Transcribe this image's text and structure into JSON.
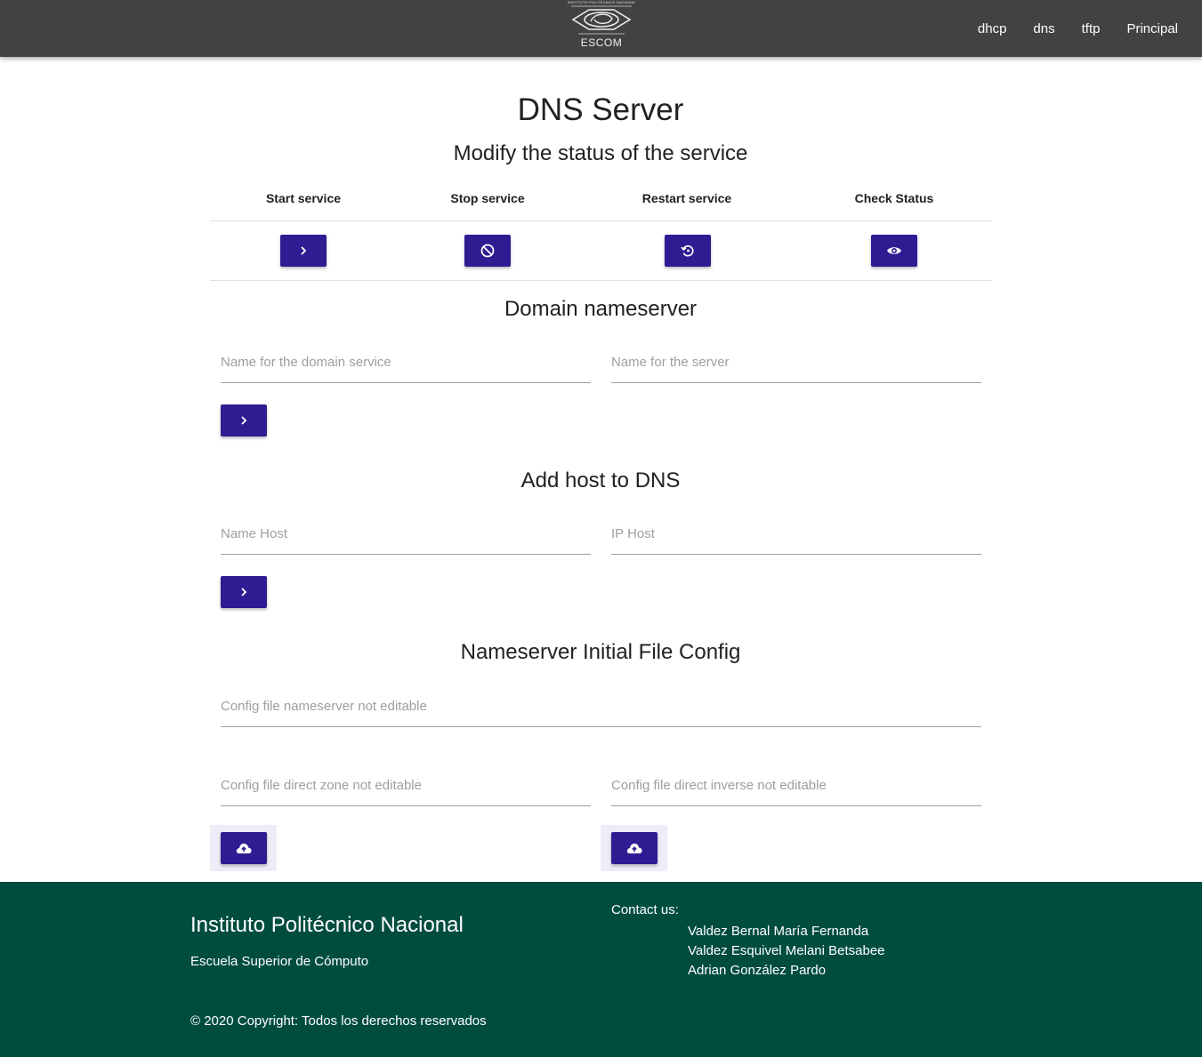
{
  "navbar": {
    "logo": {
      "small_text": "INSTITUTO POLITÉCNICO NACIONAL",
      "text": "ESCOM"
    },
    "links": [
      "dhcp",
      "dns",
      "tftp",
      "Principal"
    ]
  },
  "page": {
    "title": "DNS Server",
    "service_section": {
      "heading": "Modify the status of the service",
      "columns": [
        "Start service",
        "Stop service",
        "Restart service",
        "Check Status"
      ],
      "icons": [
        "chevron-right-icon",
        "block-icon",
        "restart-icon",
        "eye-icon"
      ]
    },
    "nameserver_section": {
      "heading": "Domain nameserver",
      "domain_placeholder": "Name for the domain service",
      "server_placeholder": "Name for the server"
    },
    "host_section": {
      "heading": "Add host to DNS",
      "name_placeholder": "Name Host",
      "ip_placeholder": "IP Host"
    },
    "config_section": {
      "heading": "Nameserver Initial File Config",
      "nameserver_placeholder": "Config file nameserver not editable",
      "direct_zone_placeholder": "Config file direct zone not editable",
      "direct_inverse_placeholder": "Config file direct inverse not editable"
    }
  },
  "footer": {
    "title": "Instituto Politécnico Nacional",
    "subtitle": "Escuela Superior de Cómputo",
    "contact_label": "Contact us:",
    "contacts": [
      "Valdez Bernal María Fernanda",
      "Valdez Esquivel Melani Betsabee",
      "Adrian González Pardo"
    ],
    "copyright": "© 2020 Copyright: Todos los derechos reservados"
  },
  "colors": {
    "navbar": "#424242",
    "button": "#311b92",
    "footer": "#004d40"
  }
}
